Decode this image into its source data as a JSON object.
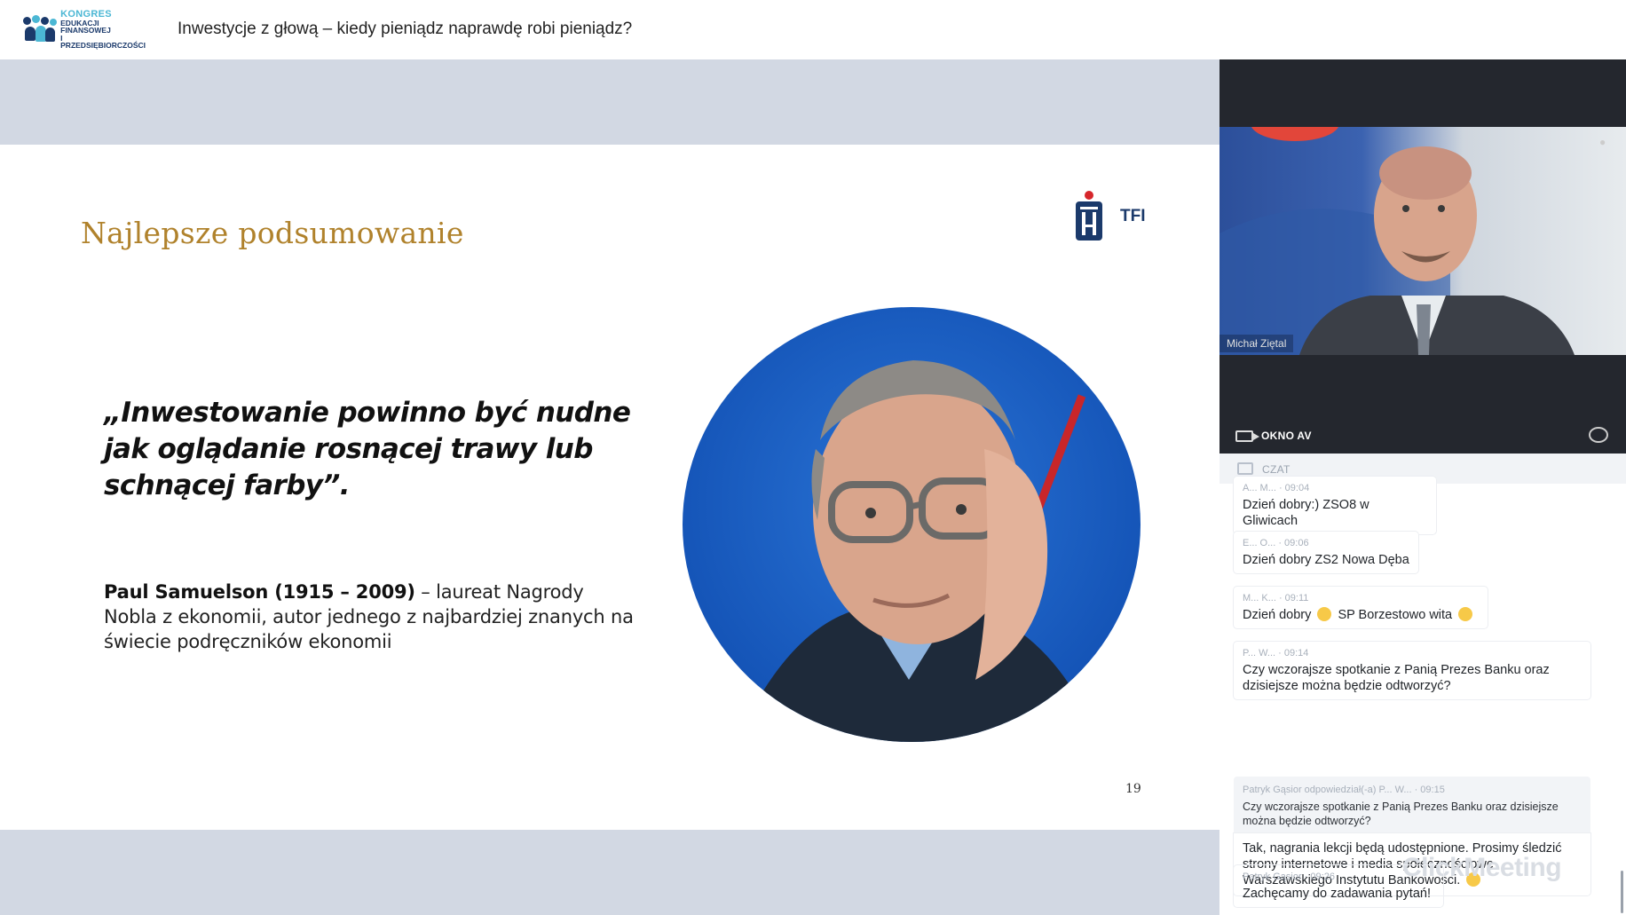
{
  "header": {
    "logo": {
      "line1": "KONGRES",
      "line2": "EDUKACJI FINANSOWEJ",
      "line3": "I PRZEDSIĘBIORCZOŚCI"
    },
    "title": "Inwestycje z głową – kiedy pieniądz naprawdę robi pieniądz?"
  },
  "slide": {
    "title": "Najlepsze podsumowanie",
    "brand": "TFI",
    "quote": "„Inwestowanie powinno być nudne jak oglądanie rosnącej trawy lub schnącej farby”.",
    "bio_name": "Paul Samuelson (1915 – 2009)",
    "bio_rest": " – laureat Nagrody Nobla z ekonomii, autor jednego z najbardziej znanych na świecie podręczników ekonomii",
    "page_number": "19"
  },
  "panel": {
    "speaker_name": "Michał Ziętal",
    "av_label": "OKNO AV",
    "chat_label": "CZAT",
    "messages": [
      {
        "meta": "A... M...  ·  09:04",
        "text": "Dzień dobry:) ZSO8 w Gliwicach"
      },
      {
        "meta": "E... O...  ·  09:06",
        "text": "Dzień dobry ZS2 Nowa Dęba"
      },
      {
        "meta": "M... K...  ·  09:11",
        "text_a": "Dzień dobry",
        "text_b": "SP Borzestowo wita"
      },
      {
        "meta": "P... W...  ·  09:14",
        "text": "Czy wczorajsze spotkanie z Panią Prezes Banku oraz dzisiejsze można będzie odtworzyć?"
      }
    ],
    "reply": {
      "meta": "Patryk Gąsior odpowiedział(-a) P... W...  ·  09:15",
      "quoted": "Czy wczorajsze spotkanie z Panią Prezes Banku oraz dzisiejsze można będzie odtworzyć?",
      "answer": "Tak, nagrania lekcji będą udostępnione. Prosimy śledzić strony internetowe i media społecznościowe Warszawskiego Instytutu Bankowości."
    },
    "last": {
      "meta": "Patryk Gąsior  ·  09:26",
      "text": "Zachęcamy do zadawania pytań!"
    },
    "watermark": "ClickMeeting"
  }
}
